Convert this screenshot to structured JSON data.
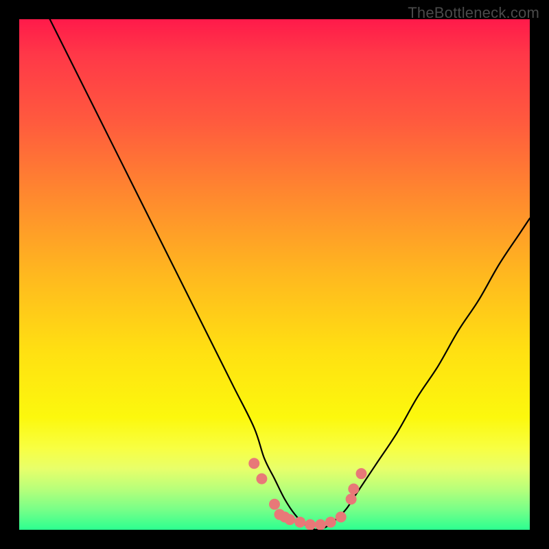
{
  "watermark": "TheBottleneck.com",
  "chart_data": {
    "type": "line",
    "title": "",
    "xlabel": "",
    "ylabel": "",
    "xlim": [
      0,
      100
    ],
    "ylim": [
      0,
      100
    ],
    "grid": false,
    "legend": false,
    "series": [
      {
        "name": "left-curve",
        "x": [
          6,
          10,
          14,
          18,
          22,
          26,
          30,
          34,
          38,
          42,
          46,
          48,
          50,
          52,
          54,
          56,
          58
        ],
        "values": [
          100,
          92,
          84,
          76,
          68,
          60,
          52,
          44,
          36,
          28,
          20,
          14,
          10,
          6,
          3,
          1,
          0
        ]
      },
      {
        "name": "right-curve",
        "x": [
          58,
          60,
          62,
          64,
          66,
          70,
          74,
          78,
          82,
          86,
          90,
          94,
          98,
          100
        ],
        "values": [
          0,
          0.5,
          2,
          4,
          7,
          13,
          19,
          26,
          32,
          39,
          45,
          52,
          58,
          61
        ]
      }
    ],
    "markers": [
      {
        "x": 46,
        "y": 13
      },
      {
        "x": 47.5,
        "y": 10
      },
      {
        "x": 50,
        "y": 5
      },
      {
        "x": 51,
        "y": 3
      },
      {
        "x": 52,
        "y": 2.5
      },
      {
        "x": 53,
        "y": 2
      },
      {
        "x": 55,
        "y": 1.5
      },
      {
        "x": 57,
        "y": 1
      },
      {
        "x": 59,
        "y": 1
      },
      {
        "x": 61,
        "y": 1.5
      },
      {
        "x": 63,
        "y": 2.5
      },
      {
        "x": 65,
        "y": 6
      },
      {
        "x": 65.5,
        "y": 8
      },
      {
        "x": 67,
        "y": 11
      }
    ],
    "colors": {
      "gradient_top": "#ff1a4a",
      "gradient_mid": "#ffe012",
      "gradient_bottom": "#2cff90",
      "curve": "#000000",
      "marker": "#e87878",
      "frame": "#000000"
    }
  }
}
